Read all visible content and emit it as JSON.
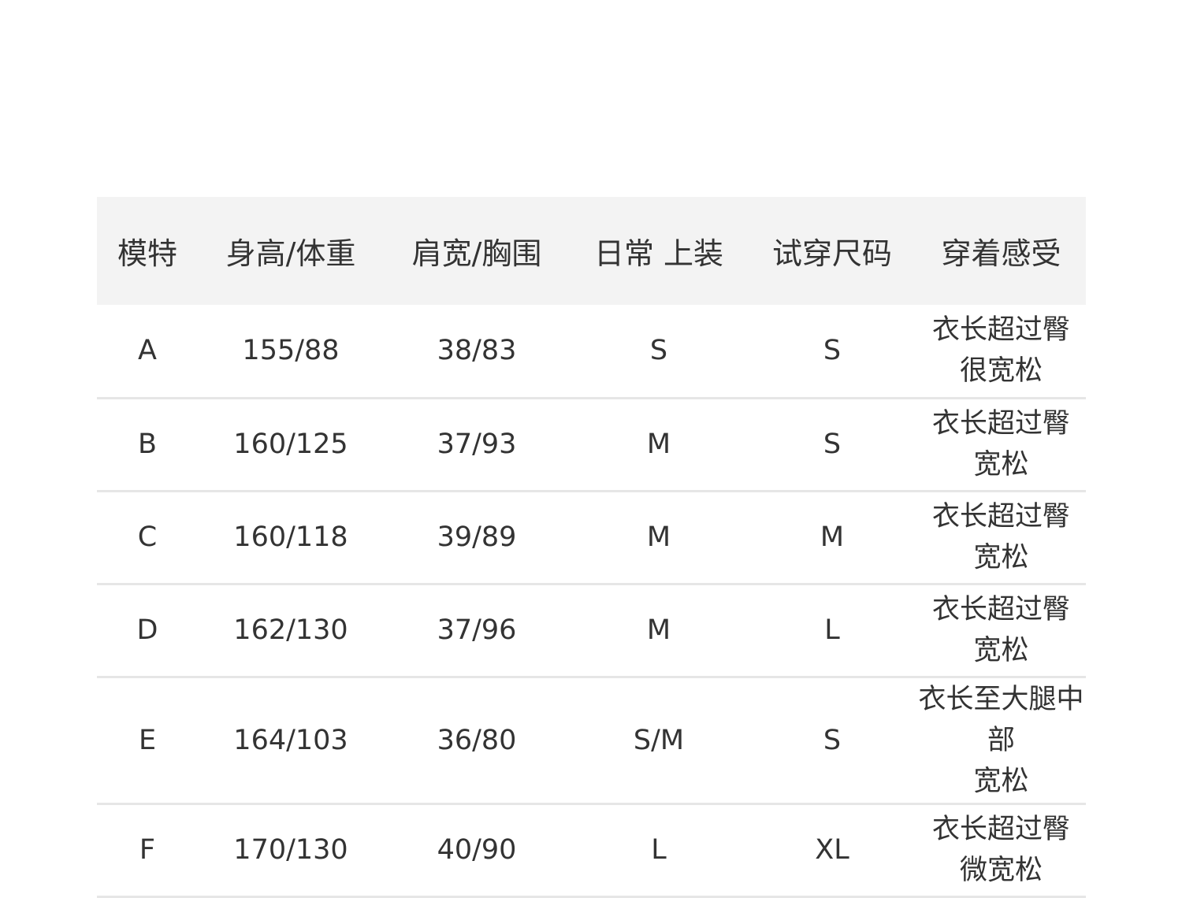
{
  "table": {
    "headers": [
      "模特",
      "身高/体重",
      "肩宽/胸围",
      "日常 上装",
      "试穿尺码",
      "穿着感受"
    ],
    "rows": [
      {
        "model": "A",
        "height_weight": "155/88",
        "shoulder_chest": "38/83",
        "daily_top": "S",
        "try_size": "S",
        "feel_line1": "衣长超过臀",
        "feel_line2": "很宽松",
        "feel_line3": ""
      },
      {
        "model": "B",
        "height_weight": "160/125",
        "shoulder_chest": "37/93",
        "daily_top": "M",
        "try_size": "S",
        "feel_line1": "衣长超过臀",
        "feel_line2": "宽松",
        "feel_line3": ""
      },
      {
        "model": "C",
        "height_weight": "160/118",
        "shoulder_chest": "39/89",
        "daily_top": "M",
        "try_size": "M",
        "feel_line1": "衣长超过臀",
        "feel_line2": "宽松",
        "feel_line3": ""
      },
      {
        "model": "D",
        "height_weight": "162/130",
        "shoulder_chest": "37/96",
        "daily_top": "M",
        "try_size": "L",
        "feel_line1": "衣长超过臀",
        "feel_line2": "宽松",
        "feel_line3": ""
      },
      {
        "model": "E",
        "height_weight": "164/103",
        "shoulder_chest": "36/80",
        "daily_top": "S/M",
        "try_size": "S",
        "feel_line1": "衣长至大腿中",
        "feel_line2": "部",
        "feel_line3": "宽松"
      },
      {
        "model": "F",
        "height_weight": "170/130",
        "shoulder_chest": "40/90",
        "daily_top": "L",
        "try_size": "XL",
        "feel_line1": "衣长超过臀",
        "feel_line2": "微宽松",
        "feel_line3": ""
      }
    ]
  }
}
